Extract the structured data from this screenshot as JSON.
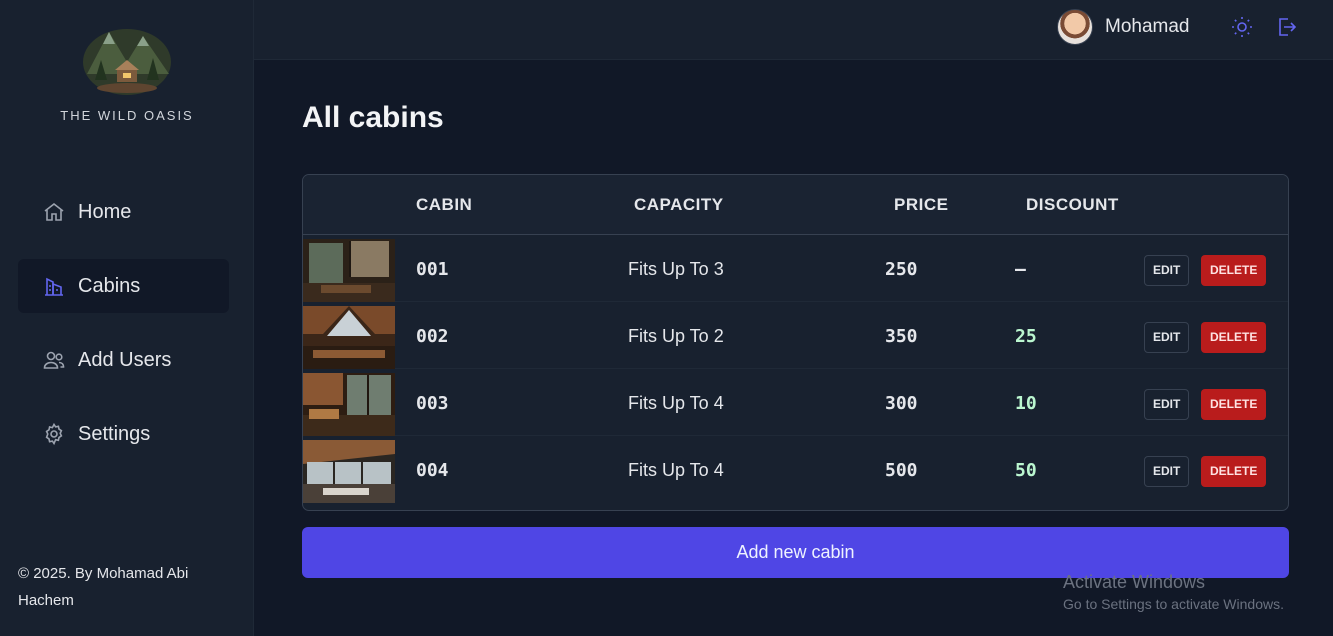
{
  "brand": {
    "name": "THE WILD OASIS"
  },
  "nav": {
    "items": [
      {
        "label": "Home",
        "icon": "home-icon"
      },
      {
        "label": "Cabins",
        "icon": "cabins-icon"
      },
      {
        "label": "Add Users",
        "icon": "users-icon"
      },
      {
        "label": "Settings",
        "icon": "settings-icon"
      }
    ],
    "active": "Cabins"
  },
  "footer": {
    "text": "© 2025. By Mohamad Abi Hachem"
  },
  "header": {
    "username": "Mohamad"
  },
  "page": {
    "title": "All cabins"
  },
  "table": {
    "columns": [
      "CABIN",
      "CAPACITY",
      "PRICE",
      "DISCOUNT"
    ],
    "rows": [
      {
        "name": "001",
        "capacity": "Fits Up To 3",
        "price": "250",
        "discount": "—"
      },
      {
        "name": "002",
        "capacity": "Fits Up To 2",
        "price": "350",
        "discount": "25"
      },
      {
        "name": "003",
        "capacity": "Fits Up To 4",
        "price": "300",
        "discount": "10"
      },
      {
        "name": "004",
        "capacity": "Fits Up To 4",
        "price": "500",
        "discount": "50"
      }
    ],
    "edit_label": "EDIT",
    "delete_label": "DELETE"
  },
  "actions": {
    "add_cabin_label": "Add new cabin"
  },
  "watermark": {
    "title": "Activate Windows",
    "subtitle": "Go to Settings to activate Windows."
  },
  "colors": {
    "accent": "#4f46e5",
    "danger": "#b91c1c",
    "background": "#111827",
    "panel": "#18212f"
  }
}
